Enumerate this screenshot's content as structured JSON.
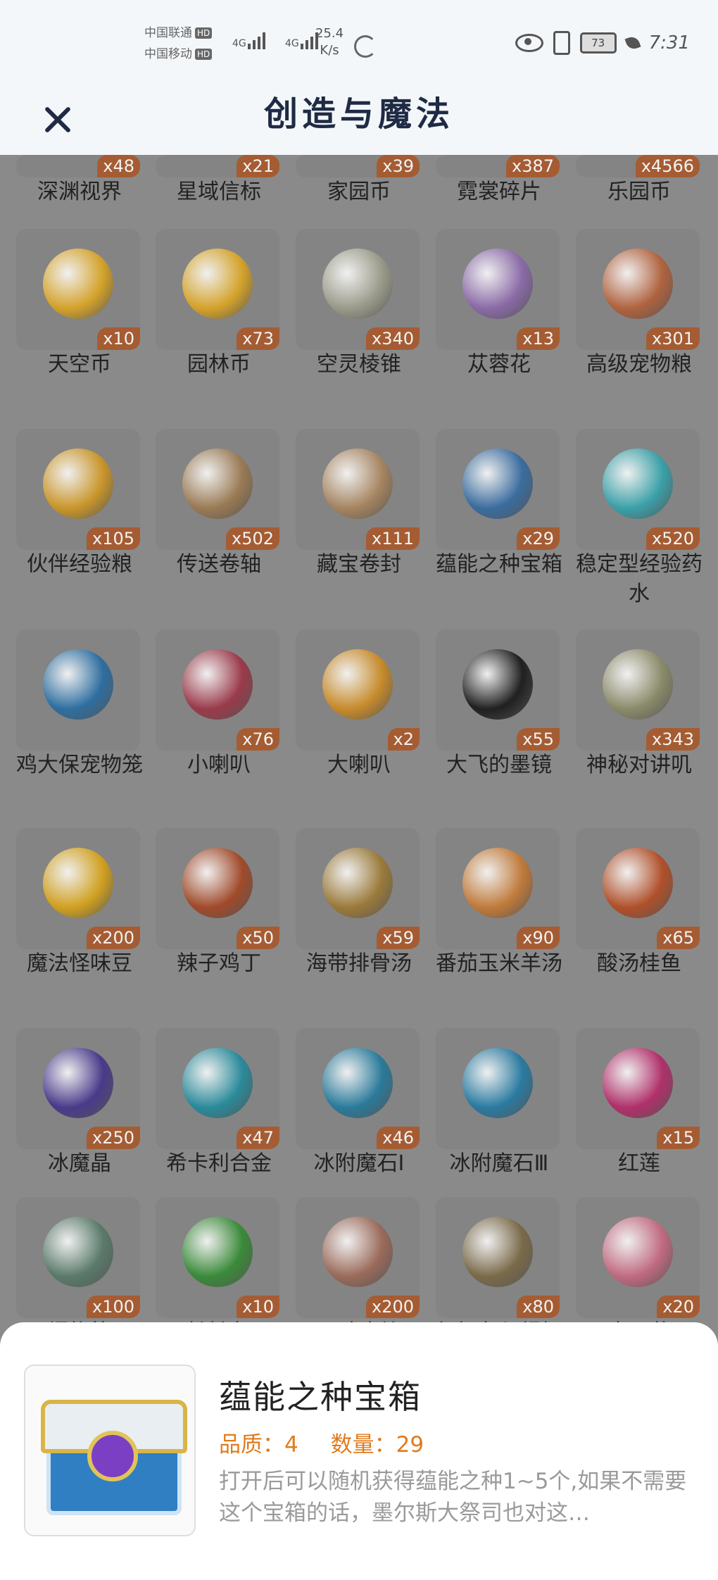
{
  "status_bar": {
    "carrier1": "中国联通",
    "carrier2": "中国移动",
    "hd": "HD",
    "network": "4G",
    "speed_value": "25.4",
    "speed_unit": "K/s",
    "battery": "73",
    "time": "7:31"
  },
  "header": {
    "title": "创造与魔法"
  },
  "items": [
    {
      "name": "深渊视界",
      "count": "x48",
      "color": "#9a8a60"
    },
    {
      "name": "星域信标",
      "count": "x21",
      "color": "#6a8c9a"
    },
    {
      "name": "家园币",
      "count": "x39",
      "color": "#c9a43a"
    },
    {
      "name": "霓裳碎片",
      "count": "x387",
      "color": "#a07ab0"
    },
    {
      "name": "乐园币",
      "count": "x4566",
      "color": "#c9a43a"
    },
    {
      "name": "天空币",
      "count": "x10",
      "color": "#d4a22a"
    },
    {
      "name": "园林币",
      "count": "x73",
      "color": "#d4a22a"
    },
    {
      "name": "空灵棱锥",
      "count": "x340",
      "color": "#9a9a8a"
    },
    {
      "name": "苁蓉花",
      "count": "x13",
      "color": "#8a6aa6"
    },
    {
      "name": "高级宠物粮",
      "count": "x301",
      "color": "#b0623e"
    },
    {
      "name": "伙伴经验粮",
      "count": "x105",
      "color": "#c9952a"
    },
    {
      "name": "传送卷轴",
      "count": "x502",
      "color": "#9a7a54"
    },
    {
      "name": "藏宝卷封",
      "count": "x111",
      "color": "#a58460"
    },
    {
      "name": "蕴能之种宝箱",
      "count": "x29",
      "color": "#3a6c9e"
    },
    {
      "name": "稳定型经验药水",
      "count": "x520",
      "color": "#3aa0a8"
    },
    {
      "name": "鸡大保宠物笼",
      "count": "",
      "color": "#2e6ea0"
    },
    {
      "name": "小喇叭",
      "count": "x76",
      "color": "#9a3a4a"
    },
    {
      "name": "大喇叭",
      "count": "x2",
      "color": "#c68a2a"
    },
    {
      "name": "大飞的墨镜",
      "count": "x55",
      "color": "#202020"
    },
    {
      "name": "神秘对讲叽",
      "count": "x343",
      "color": "#8a8a6a"
    },
    {
      "name": "魔法怪味豆",
      "count": "x200",
      "color": "#d0a020"
    },
    {
      "name": "辣子鸡丁",
      "count": "x50",
      "color": "#a04a2a"
    },
    {
      "name": "海带排骨汤",
      "count": "x59",
      "color": "#9a7a3a"
    },
    {
      "name": "番茄玉米羊汤",
      "count": "x90",
      "color": "#c07a3a"
    },
    {
      "name": "酸汤桂鱼",
      "count": "x65",
      "color": "#b0502a"
    },
    {
      "name": "冰魔晶",
      "count": "x250",
      "color": "#4a3a8a"
    },
    {
      "name": "希卡利合金",
      "count": "x47",
      "color": "#2a8a9a"
    },
    {
      "name": "冰附魔石Ⅰ",
      "count": "x46",
      "color": "#2a7a9a"
    },
    {
      "name": "冰附魔石Ⅲ",
      "count": "",
      "color": "#2a7aa0"
    },
    {
      "name": "红莲",
      "count": "x15",
      "color": "#b0306a"
    },
    {
      "name": "爆炸箭",
      "count": "x100",
      "color": "#5a7a6a"
    },
    {
      "name": "鮟鱇鱼",
      "count": "x10",
      "color": "#3a8a3a"
    },
    {
      "name": "野味肉块",
      "count": "x200",
      "color": "#9a6a5a"
    },
    {
      "name": "红鲤鱼与绿鲤鱼",
      "count": "x80",
      "color": "#7a6a4a"
    },
    {
      "name": "大王花",
      "count": "x20",
      "color": "#c06a80"
    }
  ],
  "detail": {
    "title": "蕴能之种宝箱",
    "quality": "品质：4",
    "quantity": "数量：29",
    "description": "打开后可以随机获得蕴能之种1~5个,如果不需要这个宝箱的话，墨尔斯大祭司也对这…"
  }
}
